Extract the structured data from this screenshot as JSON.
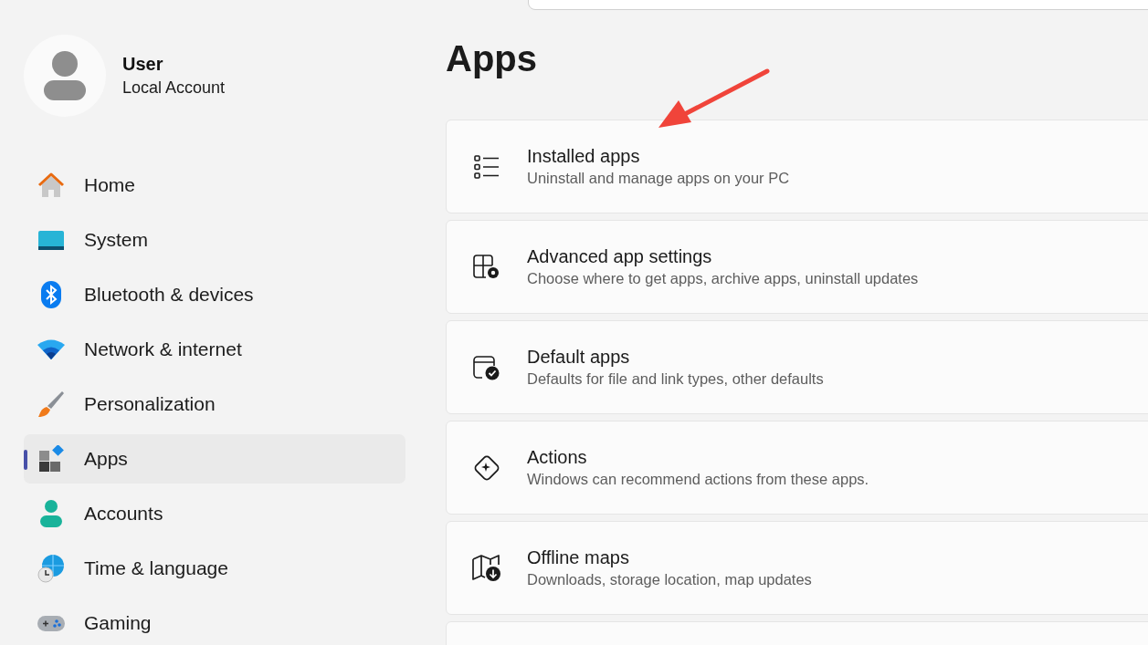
{
  "account": {
    "name": "User",
    "type": "Local Account"
  },
  "sidebar": {
    "items": [
      {
        "label": "Home",
        "selected": false
      },
      {
        "label": "System",
        "selected": false
      },
      {
        "label": "Bluetooth & devices",
        "selected": false
      },
      {
        "label": "Network & internet",
        "selected": false
      },
      {
        "label": "Personalization",
        "selected": false
      },
      {
        "label": "Apps",
        "selected": true
      },
      {
        "label": "Accounts",
        "selected": false
      },
      {
        "label": "Time & language",
        "selected": false
      },
      {
        "label": "Gaming",
        "selected": false
      }
    ]
  },
  "page": {
    "title": "Apps"
  },
  "cards": [
    {
      "title": "Installed apps",
      "description": "Uninstall and manage apps on your PC"
    },
    {
      "title": "Advanced app settings",
      "description": "Choose where to get apps, archive apps, uninstall updates"
    },
    {
      "title": "Default apps",
      "description": "Defaults for file and link types, other defaults"
    },
    {
      "title": "Actions",
      "description": "Windows can recommend actions from these apps."
    },
    {
      "title": "Offline maps",
      "description": "Downloads, storage location, map updates"
    }
  ]
}
